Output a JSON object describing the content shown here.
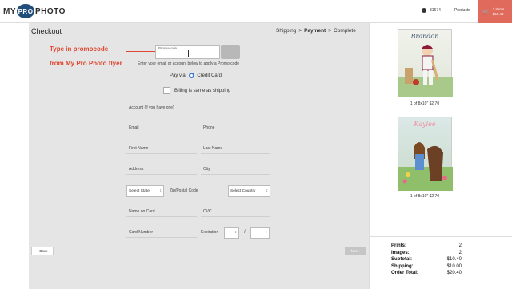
{
  "header": {
    "logo": {
      "my": "MY",
      "pro": "PRO",
      "photo": "PHOTO"
    },
    "user_id": "31674",
    "products_label": "Products",
    "cart": {
      "items": "2 items",
      "total": "$50.40"
    }
  },
  "checkout": {
    "title": "Checkout",
    "steps": [
      {
        "label": "Shipping"
      },
      {
        "label": "Payment",
        "active": true
      },
      {
        "label": "Complete"
      }
    ],
    "step_separator": ">"
  },
  "annotation": {
    "line1": "Type in promocode",
    "line2": "from My Pro Photo flyer"
  },
  "promo": {
    "label": "Promocode",
    "hint": "Enter your email or account below to apply a Promo code"
  },
  "payment": {
    "pay_via_label": "Pay via:",
    "method": "Credit Card",
    "billing_same_label": "Billing is same as shipping"
  },
  "form": {
    "account": "Account (if you have one)",
    "email": "Email",
    "phone": "Phone",
    "first_name": "First Name",
    "last_name": "Last Name",
    "address": "Address",
    "city": "City",
    "state": "Select State",
    "zip": "Zip/Postal Code",
    "country": "Select Country",
    "name_on_card": "Name on Card",
    "cvc": "CVC",
    "card_number": "Card Number",
    "expiration": "Expiration",
    "exp_sep": "/"
  },
  "nav": {
    "back": "Back",
    "next": "Next"
  },
  "cart_items": [
    {
      "title": "Brandon",
      "caption": "1 of 8x10\" $2.70"
    },
    {
      "title": "Kaylee",
      "caption": "1 of 8x10\" $2.70"
    }
  ],
  "summary": [
    {
      "label": "Prints:",
      "value": "2"
    },
    {
      "label": "Images:",
      "value": "2"
    },
    {
      "label": "Subtotal:",
      "value": "$10.40"
    },
    {
      "label": "Shipping:",
      "value": "$10.00"
    },
    {
      "label": "Order Total:",
      "value": "$20.40"
    }
  ],
  "colors": {
    "accent": "#e06b5c",
    "annotation": "#e0452f",
    "brand": "#1f4e7a",
    "radio": "#3d7bd6"
  }
}
